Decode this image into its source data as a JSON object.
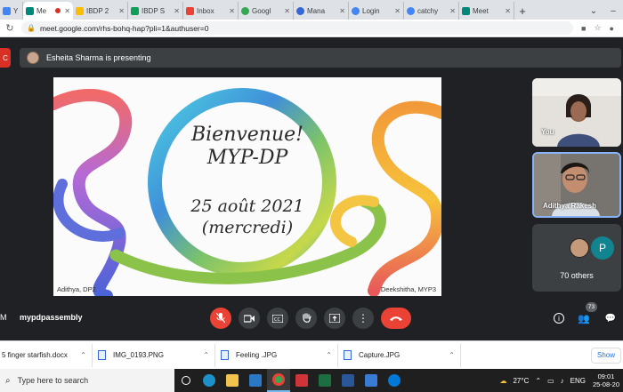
{
  "tabs": [
    {
      "label": "Y",
      "color": "#4285f4"
    },
    {
      "label": "Me",
      "color": "#00897b",
      "active": true
    },
    {
      "label": "IBDP 2",
      "color": "#fbbc04"
    },
    {
      "label": "IBDP S",
      "color": "#0f9d58"
    },
    {
      "label": "Inbox",
      "color": "#ea4335"
    },
    {
      "label": "Googl",
      "color": "#34a853"
    },
    {
      "label": "Mana",
      "color": "#3367d6"
    },
    {
      "label": "Login",
      "color": "#4285f4"
    },
    {
      "label": "catchy",
      "color": "#4285f4"
    },
    {
      "label": "Meet",
      "color": "#00897b"
    }
  ],
  "browser": {
    "url": "meet.google.com/rhs-bohq-hap?pli=1&authuser=0",
    "new_tab": "+"
  },
  "meet": {
    "left_chip": "C",
    "presenting_text": "Esheita Sharma is presenting",
    "meeting_code_prefix": "M",
    "meeting_name": "mypdpassembly",
    "participant_count": "73",
    "slide": {
      "line1": "Bienvenue!",
      "line2": "MYP-DP",
      "line3": "25 août 2021",
      "line4": "(mercredi)",
      "footer_left": "Adithya, DP2",
      "footer_right": "Deekshitha, MYP3"
    },
    "tiles": {
      "self_name": "You",
      "speaker_name": "Adithya Rakesh",
      "others_initial": "P",
      "others_label": "70 others"
    }
  },
  "downloads": [
    {
      "name": "5 finger starfish.docx"
    },
    {
      "name": "IMG_0193.PNG"
    },
    {
      "name": "Feeling .JPG"
    },
    {
      "name": "Capture.JPG"
    }
  ],
  "downloads_show_all": "Show",
  "taskbar": {
    "search_placeholder": "Type here to search",
    "weather": "27°C",
    "language": "ENG",
    "time": "09:01",
    "date": "25-08-20"
  },
  "colors": {
    "meet_bg": "#202124",
    "hangup": "#ea4335",
    "accent": "#1a73e8"
  }
}
